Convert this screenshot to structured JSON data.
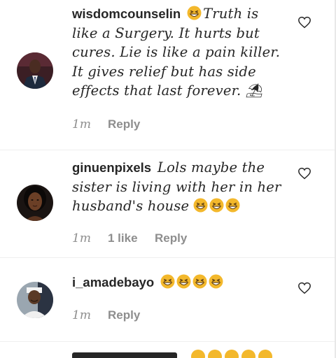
{
  "comments": [
    {
      "username": "wisdomcounselin",
      "text_before_emoji": "",
      "text": "Truth is like a Surgery. It hurts but cures. Lie is like a pain killer. It gives relief but has side effects that last forever. ⛱",
      "time": "1m",
      "likes": "",
      "reply": "Reply"
    },
    {
      "username": "ginuenpixels",
      "text": "Lols maybe the sister is living with her in her husband's house",
      "time": "1m",
      "likes": "1 like",
      "reply": "Reply"
    },
    {
      "username": "i_amadebayo",
      "text": "",
      "time": "1m",
      "likes": "",
      "reply": "Reply"
    }
  ],
  "icons": {
    "emoji": "grinning-squinting-face-icon",
    "heart": "heart-outline-icon"
  },
  "colors": {
    "text": "#262626",
    "muted": "#8e8e8e",
    "emoji": "#f3b82c"
  }
}
